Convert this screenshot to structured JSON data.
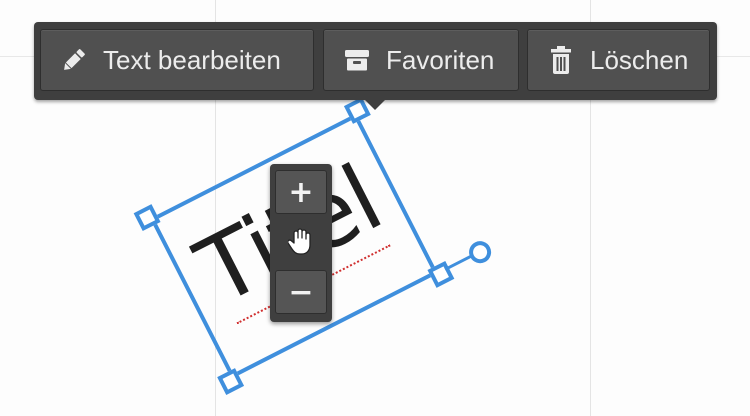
{
  "toolbar": {
    "edit_label": "Text bearbeiten",
    "favorite_label": "Favoriten",
    "delete_label": "Löschen",
    "edit_icon": "pencil-icon",
    "favorite_icon": "archive-box-icon",
    "delete_icon": "trash-icon"
  },
  "text_object": {
    "text": "Titel",
    "rotation_deg": -27,
    "selection_color": "#3f8fdd",
    "spellcheck_error": true
  },
  "zoom_control": {
    "zoom_in_label": "+",
    "zoom_out_label": "−",
    "move_icon": "hand-grab-icon"
  },
  "colors": {
    "toolbar_bg": "#3f3f3f",
    "button_bg": "#505050",
    "button_text": "#ececec",
    "canvas_bg": "#fdfdfd",
    "guide_line": "#e4e4e4"
  }
}
